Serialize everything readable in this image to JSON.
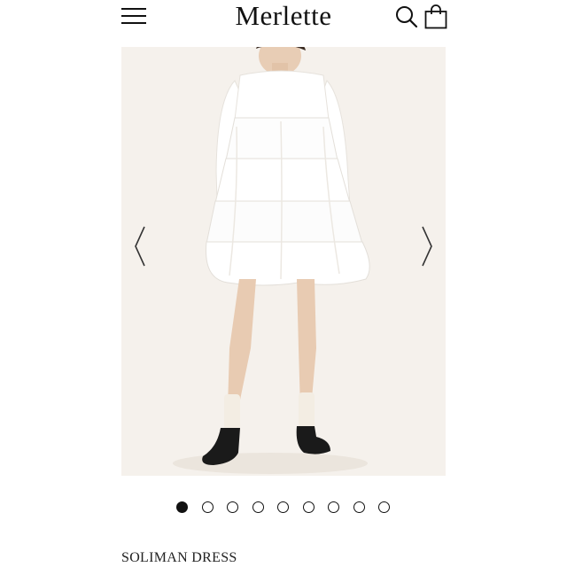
{
  "header": {
    "logo_text": "Merlette",
    "menu_icon": "hamburger-menu-icon",
    "search_icon": "search-icon",
    "bag_icon": "shopping-bag-icon"
  },
  "carousel": {
    "prev_icon": "chevron-left-icon",
    "next_icon": "chevron-right-icon",
    "slide_count": 9,
    "active_slide": 1
  },
  "product": {
    "name": "SOLIMAN DRESS"
  },
  "colors": {
    "text": "#111111",
    "photo_background": "#f5f1ec"
  }
}
